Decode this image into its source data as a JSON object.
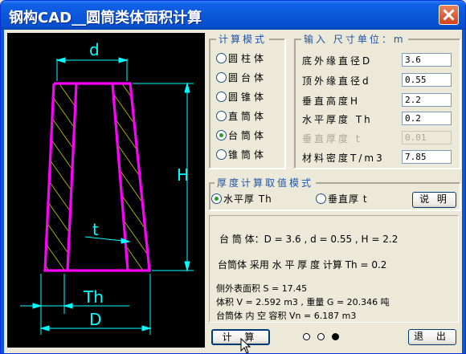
{
  "window": {
    "title": "钢构CAD__圆筒类体面积计算"
  },
  "diagram": {
    "label_top": "d",
    "label_height": "H",
    "label_t": "t",
    "label_th": "Th",
    "label_bottom": "D"
  },
  "mode_group": {
    "legend": "计算模式",
    "options": [
      {
        "label": "圆柱体",
        "selected": false
      },
      {
        "label": "圆台体",
        "selected": false
      },
      {
        "label": "圆锥体",
        "selected": false
      },
      {
        "label": "直筒体",
        "selected": false
      },
      {
        "label": "台筒体",
        "selected": true
      },
      {
        "label": "锥筒体",
        "selected": false
      }
    ]
  },
  "input_group": {
    "legend": "输入  尺寸单位：m",
    "fields": [
      {
        "label": "底外缘直径D",
        "value": "3.6",
        "enabled": true
      },
      {
        "label": "顶外缘直径d",
        "value": "0.55",
        "enabled": true
      },
      {
        "label": "垂直高度H",
        "value": "2.2",
        "enabled": true
      },
      {
        "label": "水平厚度 Th",
        "value": "0.2",
        "enabled": true
      },
      {
        "label": "垂直厚度 t",
        "value": "0.01",
        "enabled": false
      },
      {
        "label": "材料密度T/m3",
        "value": "7.85",
        "enabled": true
      }
    ]
  },
  "thickness_group": {
    "legend": "厚度计算取值模式",
    "horizontal": {
      "label": "水平厚 Th",
      "selected": true
    },
    "vertical": {
      "label": "垂直厚 t",
      "selected": false
    },
    "help_button": "说 明"
  },
  "results": {
    "line1": "台 筒 体：D = 3.6 , d = 0.55 , H = 2.2",
    "line2": "台筒体 采用 水 平 厚 度 计算 Th = 0.2",
    "line3": "侧外表面积 S = 17.45",
    "line4": "体积 V = 2.592 m3 , 重量 G = 20.346 吨",
    "line5": "台筒体 内 空 容积 Vn = 6.187 m3"
  },
  "footer": {
    "calc_button": "计  算",
    "exit_button": "退 出",
    "pager_active": 2
  },
  "colors": {
    "titlebar": "#0A58D8",
    "magenta": "#FF00FF",
    "cyan": "#00FFFF",
    "yellow": "#FFFF00",
    "white": "#FFFFFF"
  }
}
